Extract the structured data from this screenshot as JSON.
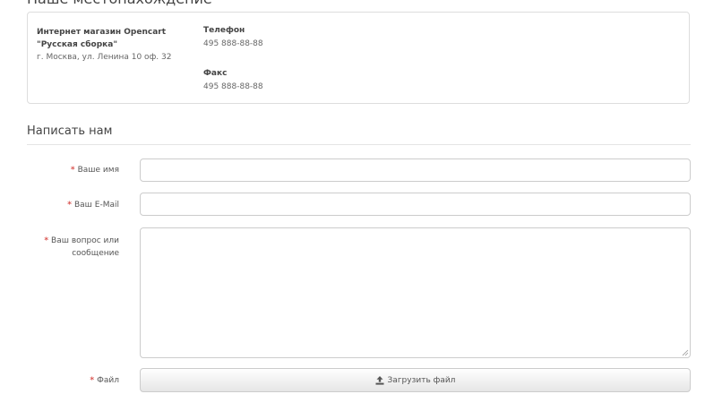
{
  "location": {
    "heading": "Наше местонахождение",
    "store_name_line1": "Интернет магазин Opencart",
    "store_name_line2": "\"Русская сборка\"",
    "address": "г. Москва, ул. Ленина 10 оф. 32",
    "phone_label": "Телефон",
    "phone_value": "495 888-88-88",
    "fax_label": "Факс",
    "fax_value": "495 888-88-88"
  },
  "contact_form": {
    "legend": "Написать нам",
    "required_mark": "*",
    "name_label": "Ваше имя",
    "name_value": "",
    "email_label": "Ваш E-Mail",
    "email_value": "",
    "enquiry_label_line1": "Ваш вопрос или",
    "enquiry_label_line2": "сообщение",
    "enquiry_value": "",
    "file_label": "Файл",
    "upload_button_label": "Загрузить файл",
    "upload_icon": "upload-icon"
  },
  "colors": {
    "required": "#d9534f",
    "border": "#cccccc"
  }
}
